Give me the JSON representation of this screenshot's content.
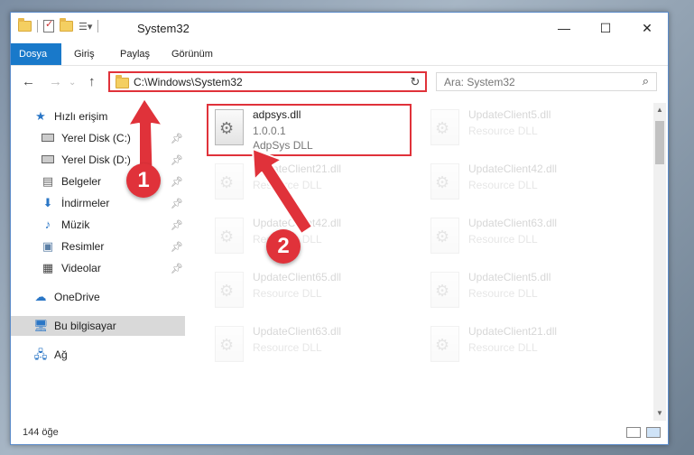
{
  "window": {
    "title": "System32"
  },
  "ribbon": {
    "tabs": [
      "Dosya",
      "Giriş",
      "Paylaş",
      "Görünüm"
    ]
  },
  "address": {
    "path": "C:\\Windows\\System32"
  },
  "search": {
    "placeholder": "Ara: System32"
  },
  "sidebar": {
    "items": [
      {
        "label": "Hızlı erişim",
        "icon": "star-icon",
        "pinned": false
      },
      {
        "label": "Yerel Disk (C:)",
        "icon": "drive-icon",
        "pinned": true
      },
      {
        "label": "Yerel Disk (D:)",
        "icon": "drive-icon",
        "pinned": true
      },
      {
        "label": "Belgeler",
        "icon": "documents-icon",
        "pinned": true
      },
      {
        "label": "İndirmeler",
        "icon": "download-icon",
        "pinned": true
      },
      {
        "label": "Müzik",
        "icon": "music-icon",
        "pinned": true
      },
      {
        "label": "Resimler",
        "icon": "pictures-icon",
        "pinned": true
      },
      {
        "label": "Videolar",
        "icon": "video-icon",
        "pinned": true
      },
      {
        "label": "OneDrive",
        "icon": "cloud-icon",
        "pinned": false
      },
      {
        "label": "Bu bilgisayar",
        "icon": "computer-icon",
        "pinned": false,
        "selected": true
      },
      {
        "label": "Ağ",
        "icon": "network-icon",
        "pinned": false
      }
    ]
  },
  "files": [
    {
      "name": "adpsys.dll",
      "line2": "1.0.0.1",
      "line3": "AdpSys DLL",
      "highlighted": true
    },
    {
      "name": "UpdateClient5.dll",
      "line2": "Resource DLL"
    },
    {
      "name": "UpdateClient21.dll",
      "line2": "Resource DLL"
    },
    {
      "name": "UpdateClient42.dll",
      "line2": "Resource DLL"
    },
    {
      "name": "UpdateClient42.dll",
      "line2": "Resource DLL"
    },
    {
      "name": "UpdateClient63.dll",
      "line2": "Resource DLL"
    },
    {
      "name": "UpdateClient65.dll",
      "line2": "Resource DLL"
    },
    {
      "name": "UpdateClient5.dll",
      "line2": "Resource DLL"
    },
    {
      "name": "UpdateClient63.dll",
      "line2": "Resource DLL"
    },
    {
      "name": "UpdateClient21.dll",
      "line2": "Resource DLL"
    }
  ],
  "status": {
    "count": "144 öğe"
  },
  "annotations": {
    "step1": "1",
    "step2": "2",
    "color": "#e0323a"
  }
}
